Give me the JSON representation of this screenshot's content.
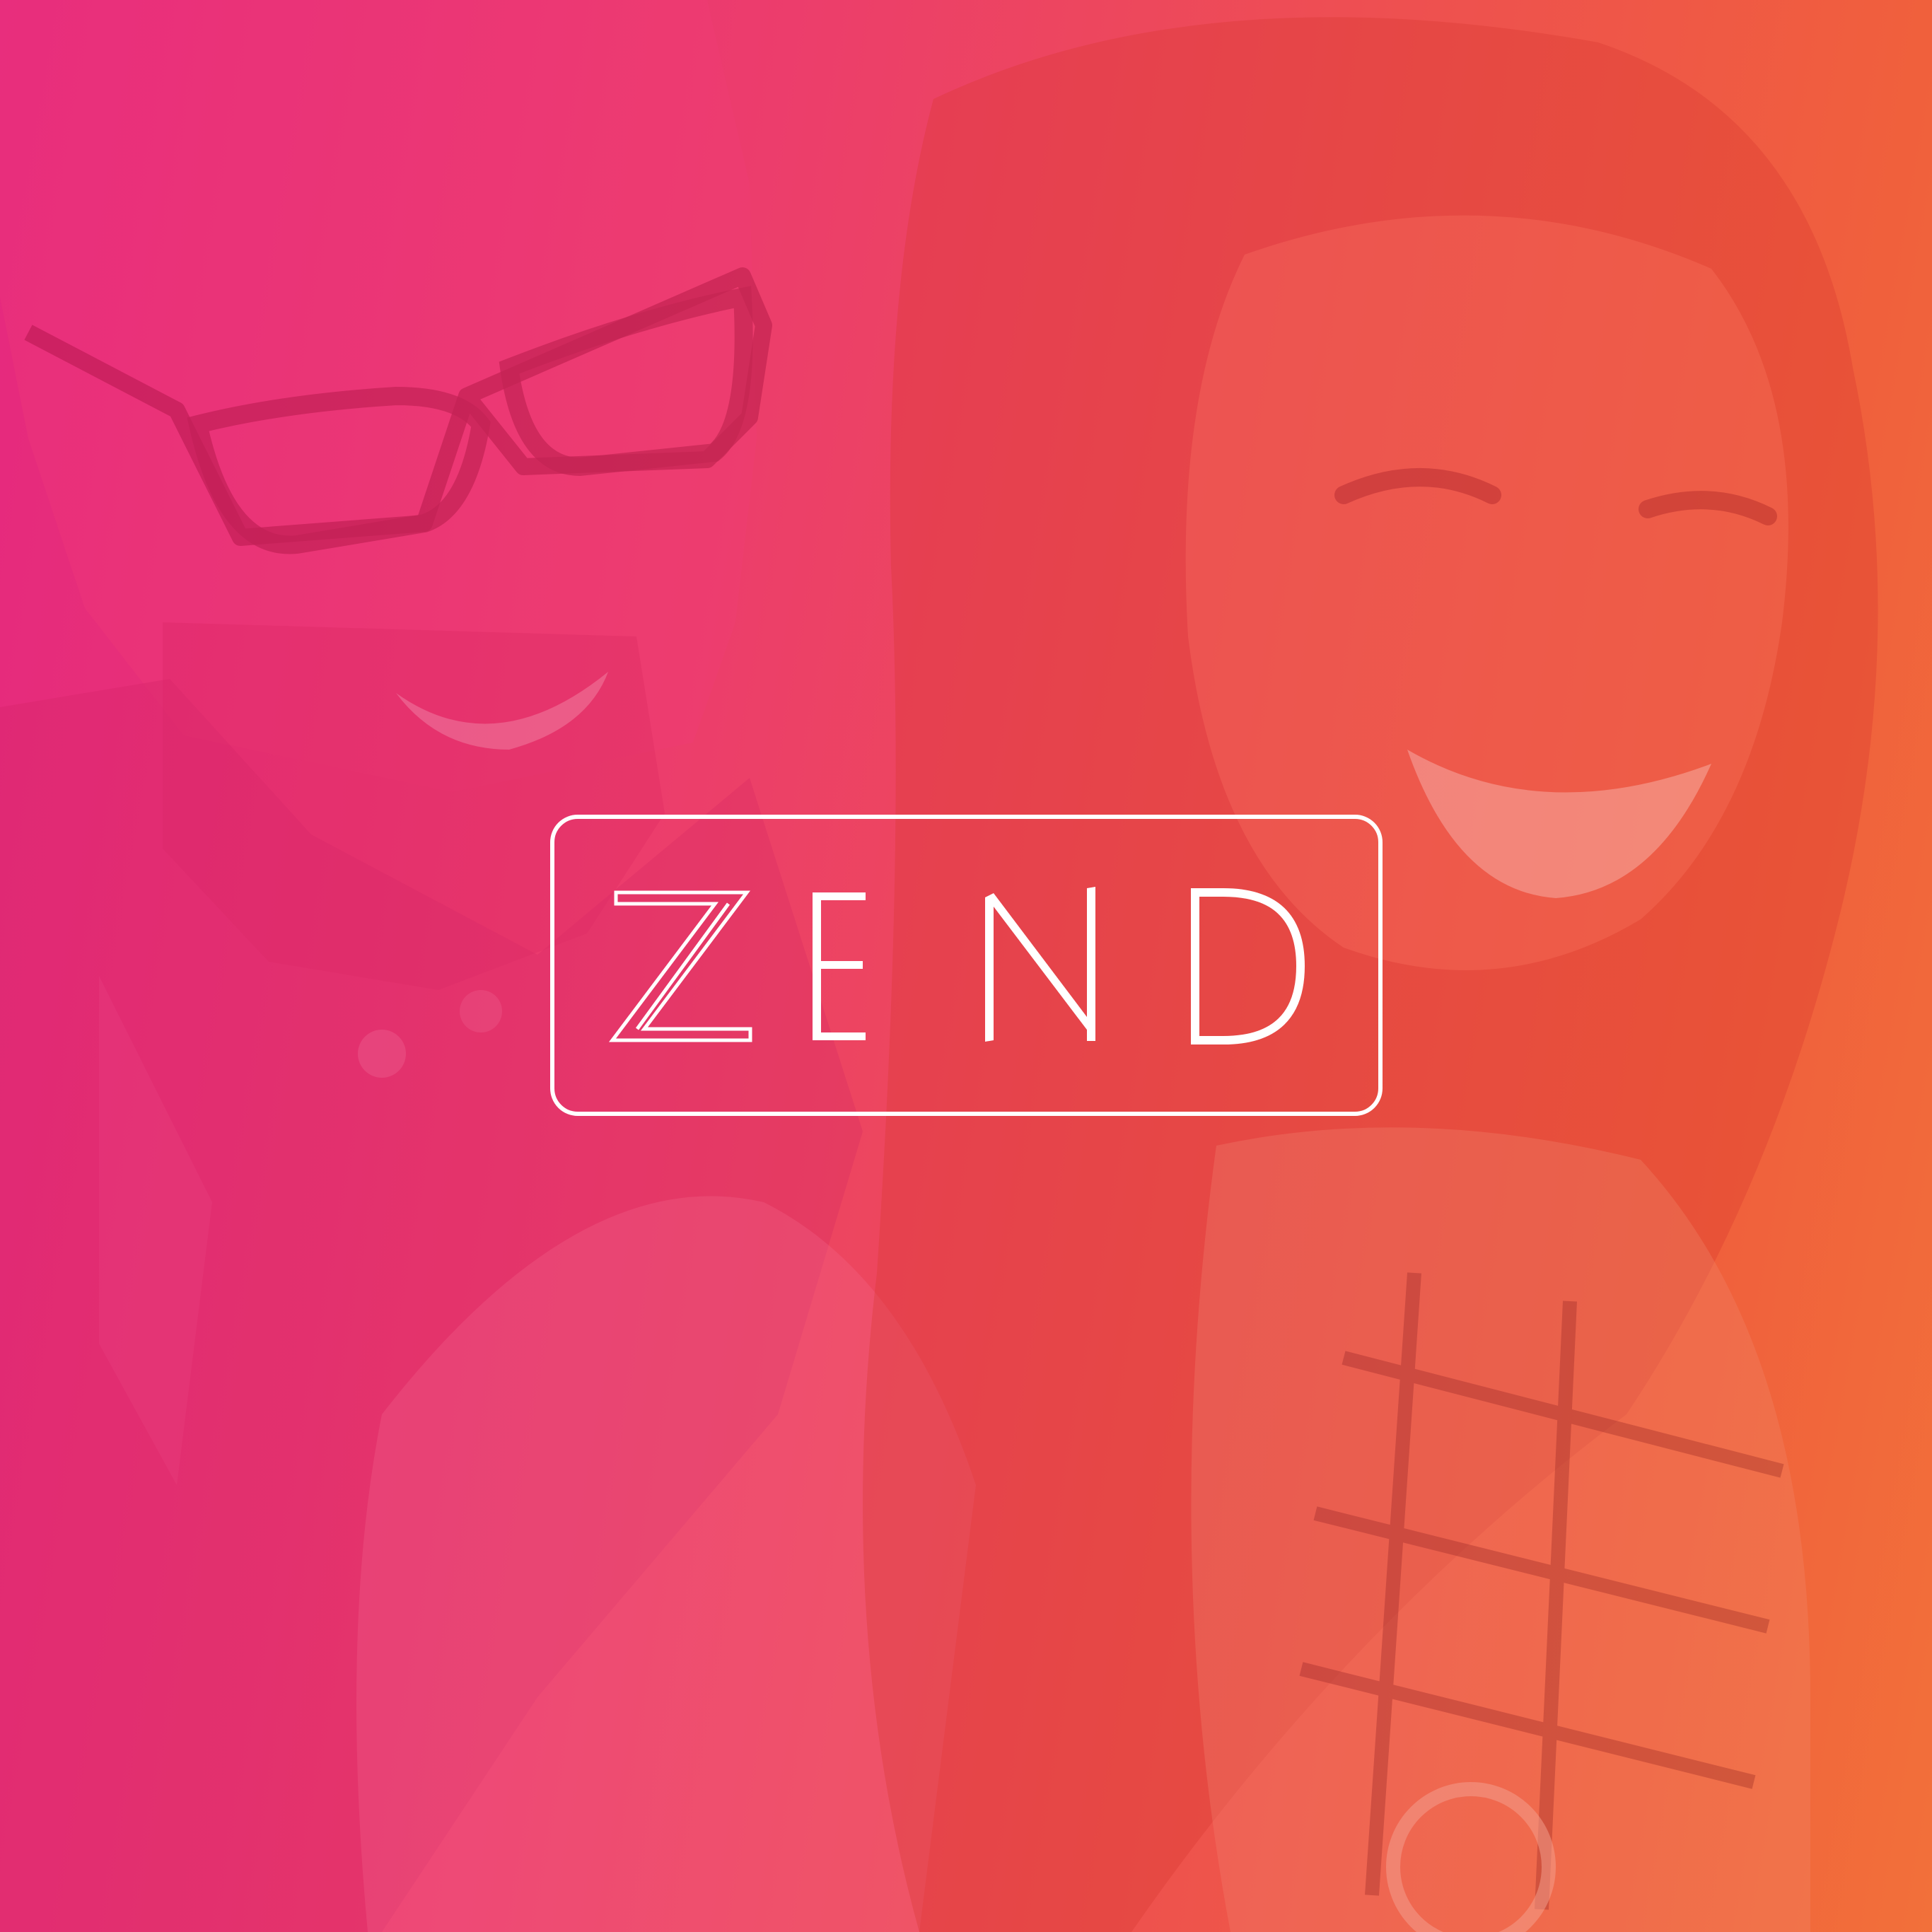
{
  "brand": {
    "wordmark": "ZEND",
    "logo_color": "#ffffff"
  },
  "background": {
    "description_colors": {
      "gradient_left": "#e5287f",
      "gradient_mid": "#ee5050",
      "gradient_right": "#f2703a"
    },
    "subject": "photo-of-two-smiling-people"
  }
}
